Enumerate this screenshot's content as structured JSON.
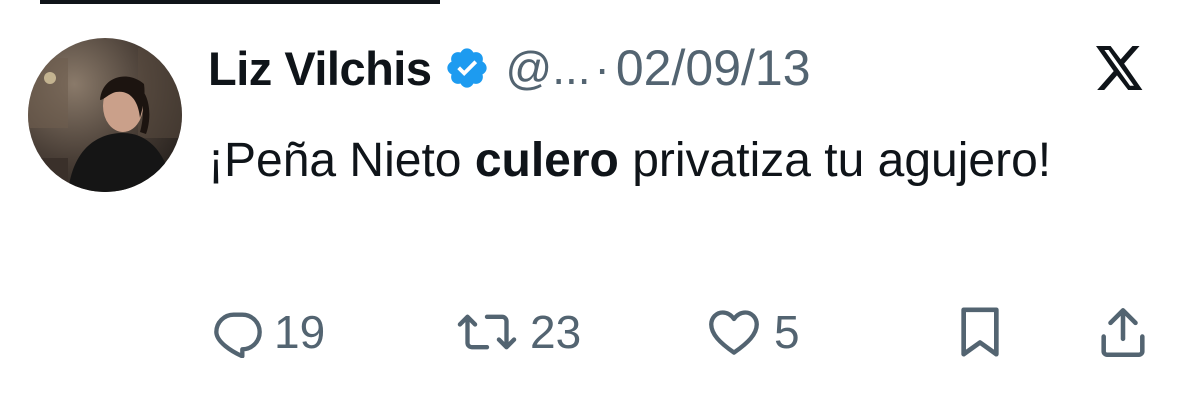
{
  "author": {
    "name": "Liz Vilchis",
    "handle": "@...",
    "separator": "·",
    "date": "02/09/13",
    "verified": true
  },
  "tweet": {
    "text_before": "¡Peña Nieto ",
    "text_bold": "culero",
    "text_after": " privatiza tu agujero!"
  },
  "actions": {
    "replies": "19",
    "retweets": "23",
    "likes": "5"
  },
  "colors": {
    "verified": "#1d9bf0",
    "muted": "#536471",
    "text": "#0f1419"
  },
  "icons": [
    "verified-badge-icon",
    "x-logo-icon",
    "reply-icon",
    "retweet-icon",
    "like-icon",
    "bookmark-icon",
    "share-icon"
  ]
}
